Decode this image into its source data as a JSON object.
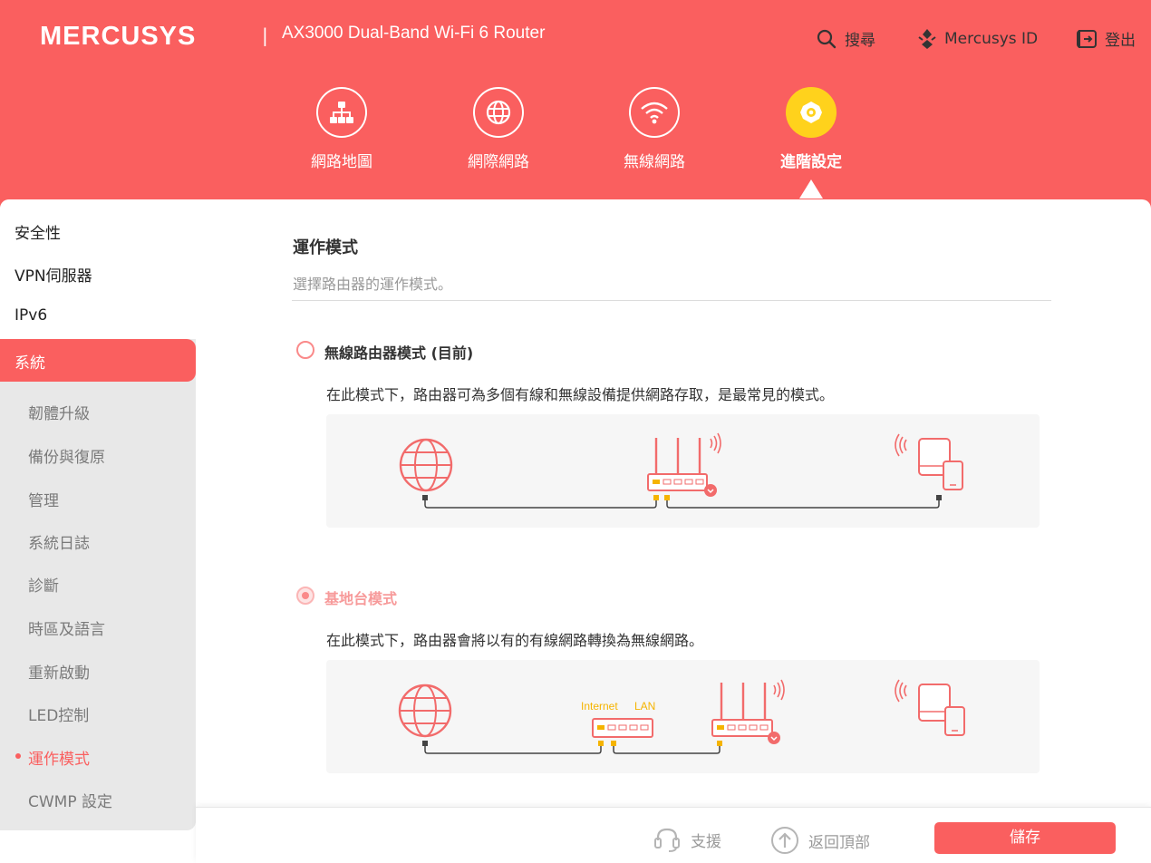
{
  "header": {
    "brand": "MERCUSYS",
    "separator": "|",
    "model": "AX3000 Dual-Band Wi-Fi 6 Router",
    "actions": {
      "search": "搜尋",
      "account": "Mercusys ID",
      "logout": "登出"
    }
  },
  "nav": {
    "items": [
      {
        "label": "網路地圖",
        "icon": "network-map-icon"
      },
      {
        "label": "網際網路",
        "icon": "globe-icon"
      },
      {
        "label": "無線網路",
        "icon": "wifi-icon"
      },
      {
        "label": "進階設定",
        "icon": "gear-icon",
        "active": true
      }
    ]
  },
  "sidebar": {
    "items": [
      "安全性",
      "VPN伺服器",
      "IPv6",
      "系統"
    ],
    "active": "系統",
    "sub_items": [
      "韌體升級",
      "備份與復原",
      "管理",
      "系統日誌",
      "診斷",
      "時區及語言",
      "重新啟動",
      "LED控制",
      "運作模式",
      "CWMP 設定"
    ],
    "current_sub": "運作模式"
  },
  "main": {
    "title": "運作模式",
    "description": "選擇路由器的運作模式。",
    "options": [
      {
        "label": "無線路由器模式 (目前)",
        "description": "在此模式下，路由器可為多個有線和無線設備提供網路存取，是最常見的模式。",
        "selected": false
      },
      {
        "label": "基地台模式",
        "description": "在此模式下，路由器會將以有的有線網路轉換為無線網路。",
        "selected": true,
        "diagram_labels": {
          "internet": "Internet",
          "lan": "LAN"
        }
      }
    ]
  },
  "footer": {
    "support": "支援",
    "back_to_top": "返回頂部",
    "save": "儲存"
  },
  "colors": {
    "brand": "#fa5f5f",
    "accent_yellow": "#ffd21c",
    "port_yellow": "#f5b400"
  }
}
